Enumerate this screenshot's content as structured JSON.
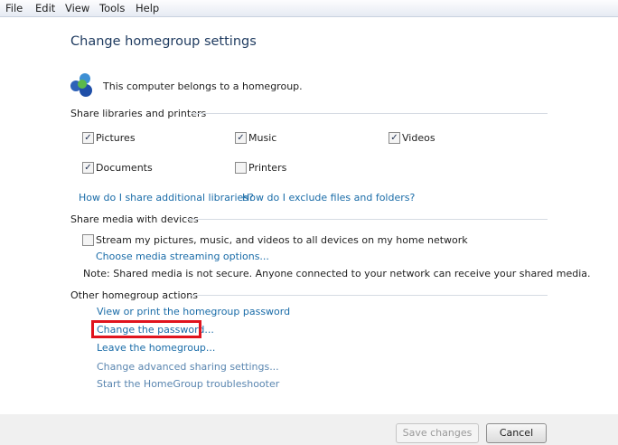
{
  "menu": [
    "File",
    "Edit",
    "View",
    "Tools",
    "Help"
  ],
  "title": "Change homegroup settings",
  "status": "This computer belongs to a homegroup.",
  "share_libraries": {
    "header": "Share libraries and printers",
    "items": [
      {
        "label": "Pictures",
        "checked": true
      },
      {
        "label": "Music",
        "checked": true
      },
      {
        "label": "Videos",
        "checked": true
      },
      {
        "label": "Documents",
        "checked": true
      },
      {
        "label": "Printers",
        "checked": false
      }
    ],
    "links": [
      "How do I share additional libraries?",
      "How do I exclude files and folders?"
    ]
  },
  "media": {
    "header": "Share media with devices",
    "stream_label": "Stream my pictures, music, and videos to all devices on my home network",
    "stream_checked": false,
    "options_link": "Choose media streaming options...",
    "note": "Note: Shared media is not secure. Anyone connected to your network can receive your shared media."
  },
  "other": {
    "header": "Other homegroup actions",
    "links": [
      "View or print the homegroup password",
      "Change the password...",
      "Leave the homegroup...",
      "Change advanced sharing settings...",
      "Start the HomeGroup troubleshooter"
    ]
  },
  "buttons": {
    "save": "Save changes",
    "cancel": "Cancel"
  }
}
